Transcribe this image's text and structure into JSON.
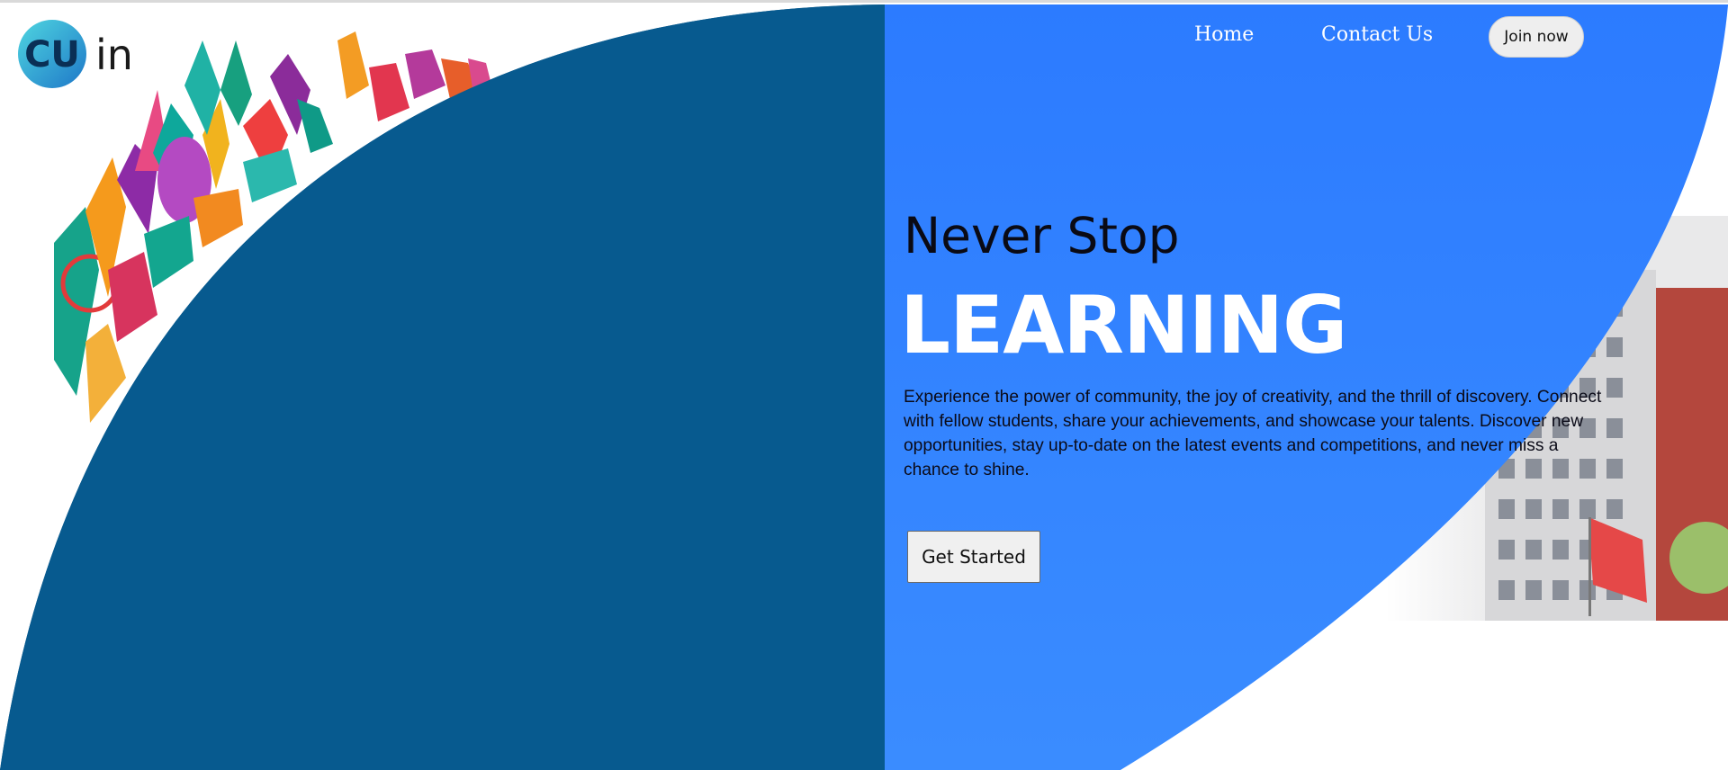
{
  "brand": {
    "logo_letters": "CU",
    "logo_suffix": "in"
  },
  "nav": {
    "home_label": "Home",
    "contact_label": "Contact Us",
    "join_label": "Join now"
  },
  "hero": {
    "kicker": "Never Stop",
    "title": "LEARNING",
    "description": "Experience the power of community, the joy of creativity, and the thrill of discovery. Connect with fellow students, share your achievements, and showcase your talents. Discover new opportunities, stay up-to-date on the latest events and competitions, and never miss a chance to shine.",
    "cta_label": "Get Started"
  },
  "colors": {
    "dark_blue": "#075A8F",
    "bright_blue": "#2C7BFF",
    "white": "#FFFFFF"
  },
  "icons": {
    "logo": "cu-logo-icon",
    "skyline": "world-landmarks-illustration",
    "campus_photo": "campus-building-photo"
  }
}
